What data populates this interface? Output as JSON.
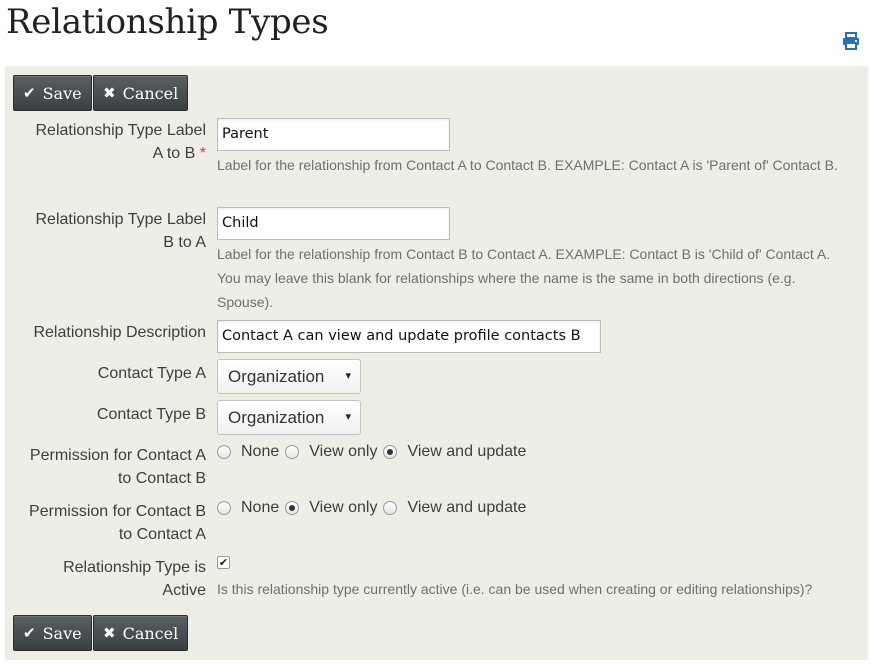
{
  "page": {
    "title": "Relationship Types"
  },
  "toolbar": {
    "save_label": "Save",
    "cancel_label": "Cancel",
    "save_icon": "✔",
    "cancel_icon": "✖"
  },
  "form": {
    "label_a_to_b": {
      "label_line1": "Relationship Type Label",
      "label_line2": "A to B",
      "required_marker": "*",
      "value": "Parent",
      "help": "Label for the relationship from Contact A to Contact B. EXAMPLE: Contact A is 'Parent of' Contact B."
    },
    "label_b_to_a": {
      "label_line1": "Relationship Type Label",
      "label_line2": "B to A",
      "value": "Child",
      "help": "Label for the relationship from Contact B to Contact A. EXAMPLE: Contact B is 'Child of' Contact A. You may leave this blank for relationships where the name is the same in both directions (e.g. Spouse)."
    },
    "description": {
      "label": "Relationship Description",
      "value": "Contact A can view and update profile contacts B"
    },
    "contact_type_a": {
      "label": "Contact Type A",
      "value": "Organization"
    },
    "contact_type_b": {
      "label": "Contact Type B",
      "value": "Organization"
    },
    "permission_a_b": {
      "label_line1": "Permission for Contact A",
      "label_line2": "to Contact B",
      "options": [
        "None",
        "View only",
        "View and update"
      ],
      "selected": "View and update"
    },
    "permission_b_a": {
      "label_line1": "Permission for Contact B",
      "label_line2": "to Contact A",
      "options": [
        "None",
        "View only",
        "View and update"
      ],
      "selected": "View only"
    },
    "is_active": {
      "label_line1": "Relationship Type is",
      "label_line2": "Active",
      "checked": true,
      "check_mark": "✔",
      "help": "Is this relationship type currently active (i.e. can be used when creating or editing relationships)?"
    }
  },
  "colors": {
    "panel_bg": "#eeeee6",
    "button_bg": "#4a4f51",
    "required": "#cf3458",
    "print_icon": "#2a6fb0"
  },
  "icons": {
    "print": "print-icon",
    "select_arrow": "▾"
  }
}
